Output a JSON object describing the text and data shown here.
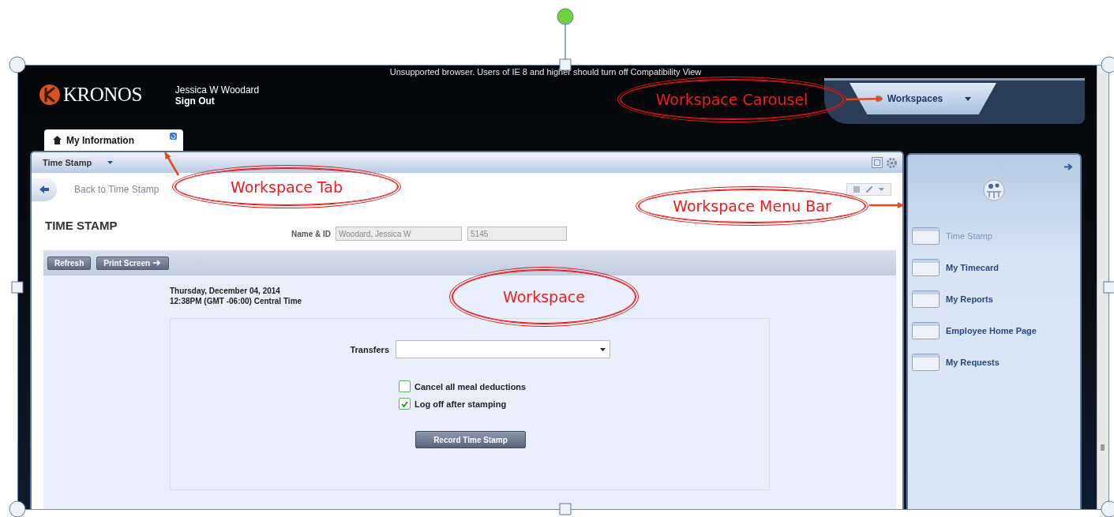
{
  "notice": "Unsupported browser. Users of IE 8 and higher should turn off Compatibility View",
  "logo": {
    "text": "KRONOS"
  },
  "user": {
    "name": "Jessica W Woodard",
    "sign_out": "Sign Out"
  },
  "carousel": {
    "label": "Workspaces"
  },
  "tabs": [
    {
      "label": "My Information",
      "selected": true
    }
  ],
  "workspace": {
    "menu": "Time Stamp",
    "back_link": "Back to Time Stamp",
    "heading": "TIME STAMP",
    "name_id": {
      "label": "Name & ID",
      "name": "Woodard, Jessica W",
      "id": "5145"
    },
    "toolbar": [
      {
        "label": "Refresh"
      },
      {
        "label": "Print Screen"
      }
    ],
    "date": "Thursday, December 04, 2014",
    "time": "12:38PM (GMT -06:00) Central Time",
    "transfers": {
      "label": "Transfers"
    },
    "options": [
      {
        "label": "Cancel all meal deductions",
        "checked": false
      },
      {
        "label": "Log off after stamping",
        "checked": true
      }
    ],
    "submit": "Record Time Stamp"
  },
  "menu_bar": {
    "items": [
      {
        "label": "Time Stamp",
        "disabled": true
      },
      {
        "label": "My Timecard",
        "disabled": false
      },
      {
        "label": "My Reports",
        "disabled": false
      },
      {
        "label": "Employee Home Page",
        "disabled": false
      },
      {
        "label": "My Requests",
        "disabled": false
      }
    ]
  },
  "annotations": [
    {
      "text": "Workspace Carousel"
    },
    {
      "text": "Workspace Tab"
    },
    {
      "text": "Workspace Menu Bar"
    },
    {
      "text": "Workspace"
    }
  ]
}
